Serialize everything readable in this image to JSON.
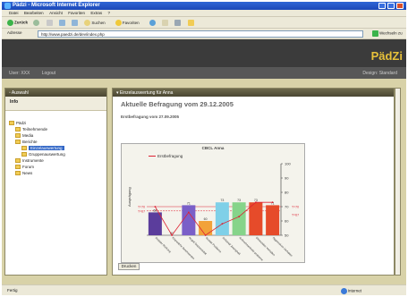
{
  "window": {
    "title": "Pädzi - Microsoft Internet Explorer"
  },
  "menu": [
    "Datei",
    "Bearbeiten",
    "Ansicht",
    "Favoriten",
    "Extras",
    "?"
  ],
  "toolbar": {
    "back": "Zurück",
    "search": "Suchen",
    "favorites": "Favoriten"
  },
  "address": {
    "label": "Adresse",
    "url": "http://www.paedzi.de/dev/index.php",
    "go": "Wechseln zu"
  },
  "app": {
    "logo": "PädZi"
  },
  "userbar": {
    "user": "User: XXX",
    "logout": "Logout",
    "theme": "Design: Standard"
  },
  "left": {
    "header": "Auswahl",
    "info": "Info",
    "tree": [
      {
        "label": "Pädzi",
        "depth": 0
      },
      {
        "label": "Teilnehmende",
        "depth": 1
      },
      {
        "label": "Media",
        "depth": 1
      },
      {
        "label": "Berichte",
        "depth": 1
      },
      {
        "label": "Einzelauswertung",
        "depth": 2,
        "selected": true
      },
      {
        "label": "Gruppenauswertung",
        "depth": 2
      },
      {
        "label": "Instrumente",
        "depth": 1
      },
      {
        "label": "Forum",
        "depth": 1
      },
      {
        "label": "News",
        "depth": 1
      }
    ]
  },
  "main": {
    "header": "Einzelauswertung für Anna",
    "heading": "Aktuelle Befragung vom 29.12.2005",
    "subheading": "Erstbefragung vom 27.09.2005",
    "back": "Drucken"
  },
  "chart_data": {
    "type": "bar",
    "title": "CBCL Anna",
    "legend": [
      "Erstbefragung"
    ],
    "ylabel": "Ausprägung",
    "categories": [
      "Sozialer Rückzug",
      "Körperliche Beschwerden",
      "Angst/ Depressivität",
      "Soziale Probleme",
      "Schizoid/ Zwanghaft",
      "Aufmerksamkeits-probleme",
      "Dissoziales Verhalten",
      "Aggressives Verhalten"
    ],
    "values": [
      66,
      50,
      71,
      60,
      73,
      73,
      73,
      71
    ],
    "series": [
      {
        "name": "Erstbefragung",
        "values": [
          70,
          50,
          66,
          50,
          58,
          63,
          73,
          73
        ]
      }
    ],
    "colors": [
      "#5b3d9c",
      "#c83a3a",
      "#7a5fc8",
      "#f2a23a",
      "#7fd0e8",
      "#86d48a",
      "#e64b2a",
      "#e64b2a"
    ],
    "yticks": [
      50,
      60,
      70,
      80,
      90,
      100
    ],
    "ylim": [
      50,
      100
    ],
    "reflines": [
      {
        "label": "T=70",
        "value": 70
      },
      {
        "label": "T=67",
        "value": 67
      }
    ]
  },
  "status": {
    "left": "Fertig",
    "right": "Internet"
  }
}
